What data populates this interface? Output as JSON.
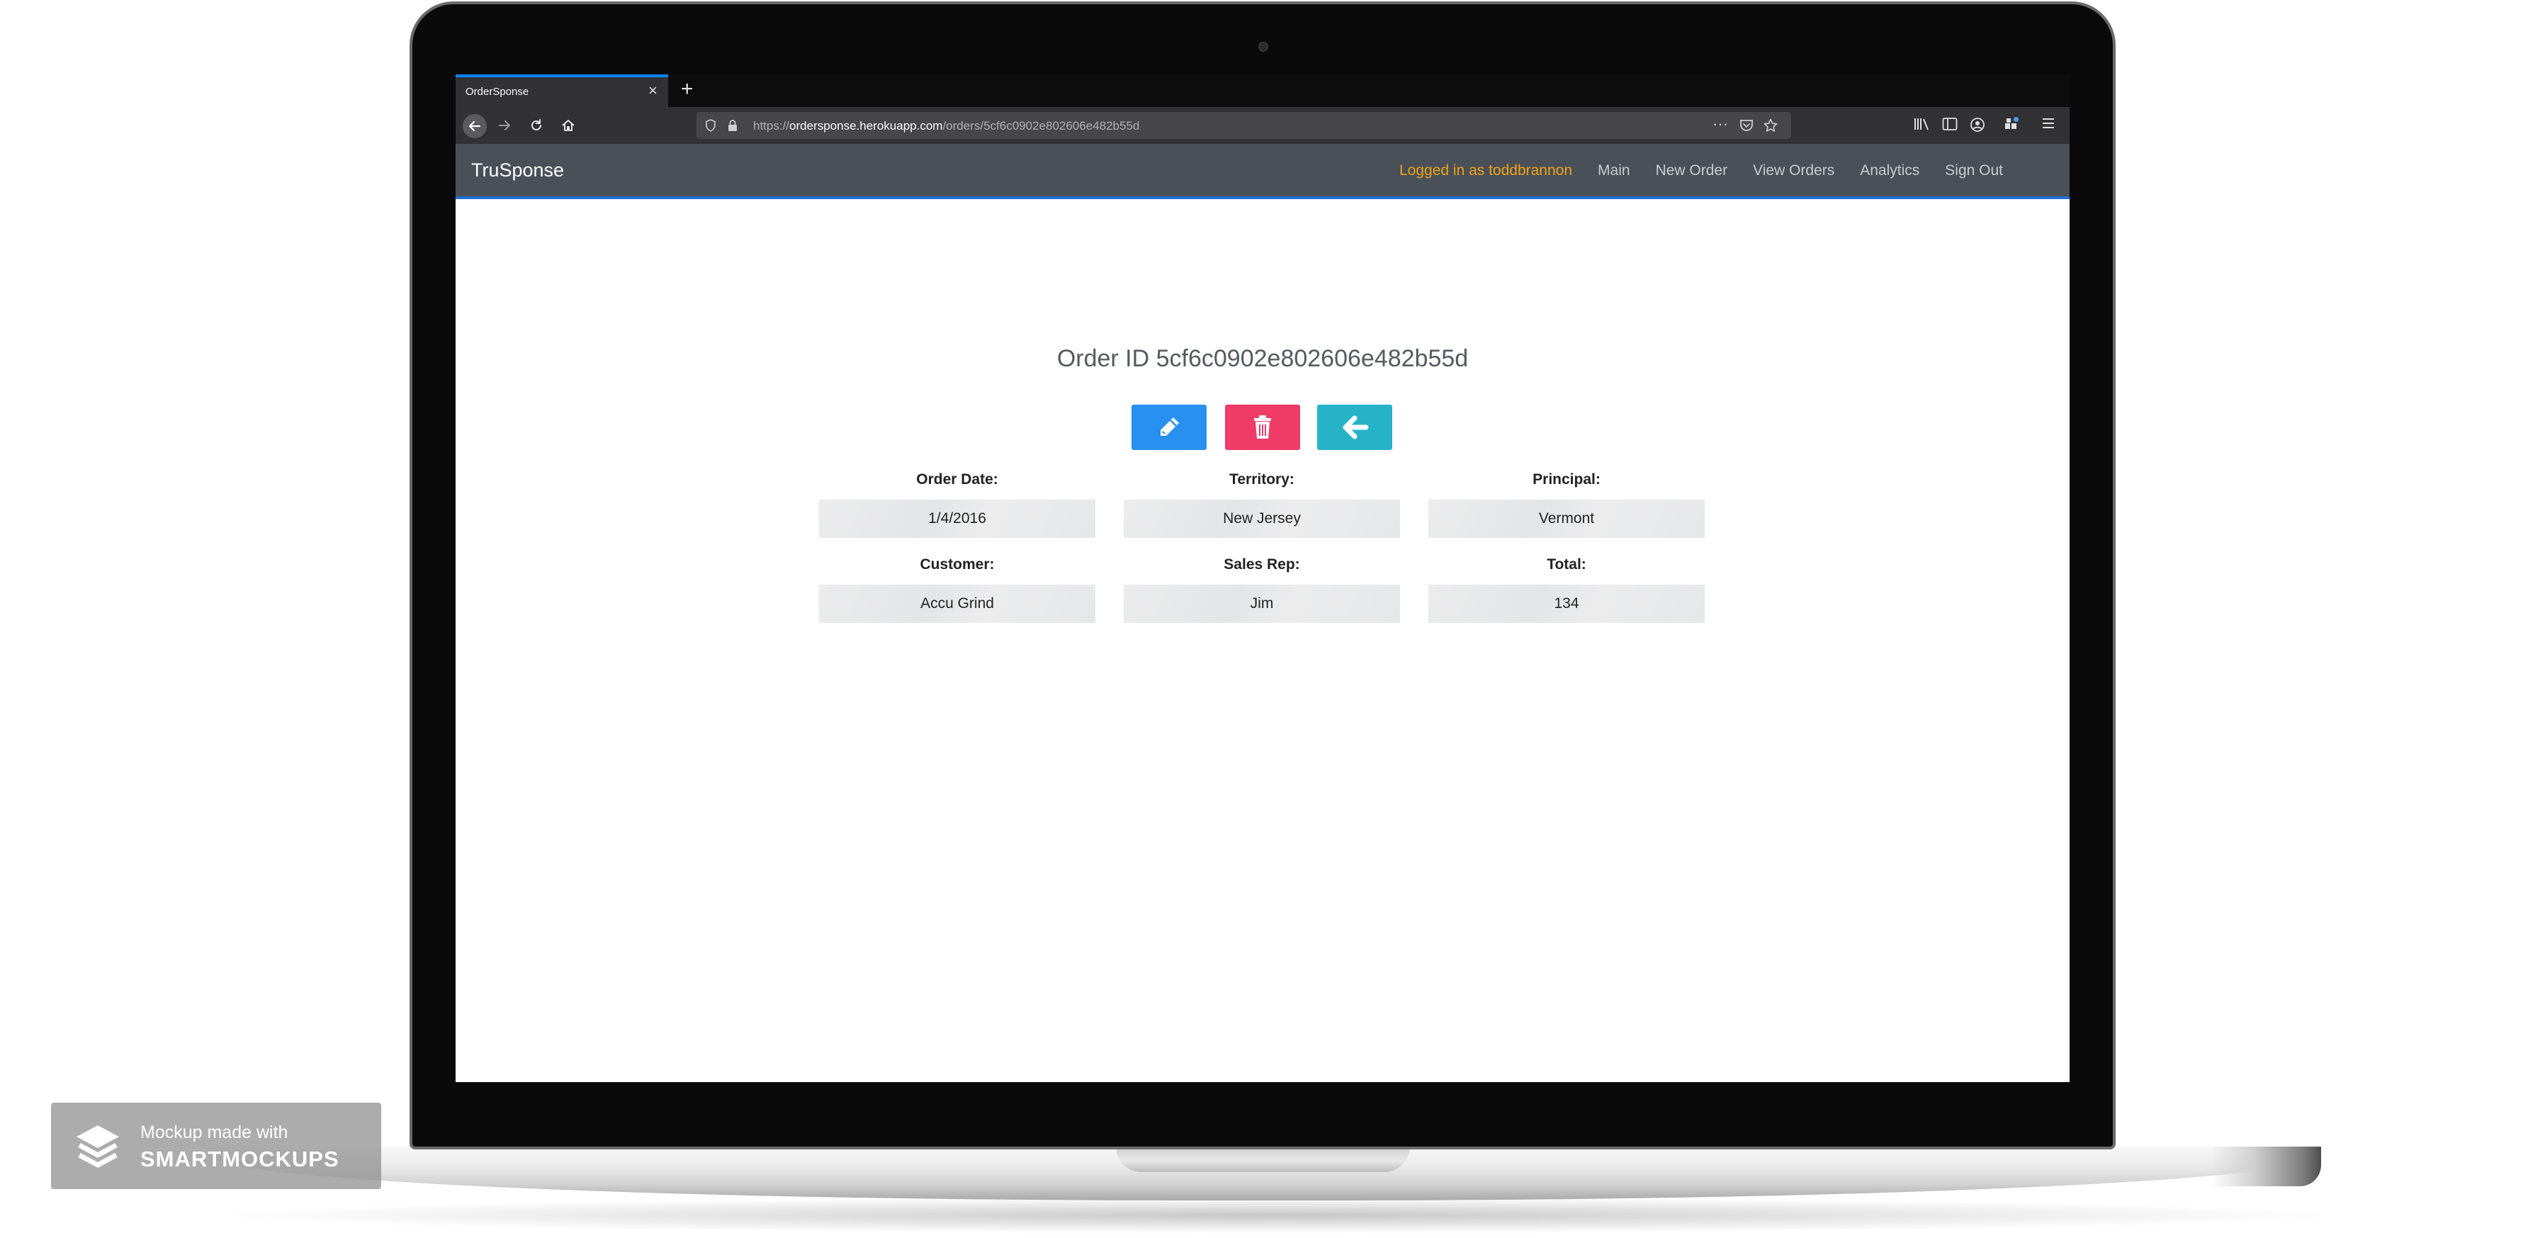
{
  "browser": {
    "tab_title": "OrderSponse",
    "tab_close": "×",
    "new_tab": "+",
    "url_prefix": "https://",
    "url_host": "ordersponse.herokuapp.com",
    "url_path": "/orders/5cf6c0902e802606e482b55d",
    "menu_dots": "···"
  },
  "app": {
    "brand": "TruSponse",
    "nav": {
      "logged_in": "Logged in as toddbrannon",
      "main": "Main",
      "new_order": "New Order",
      "view_orders": "View Orders",
      "analytics": "Analytics",
      "sign_out": "Sign Out"
    },
    "accent": "#1f6fd1",
    "user_color": "#f0a318"
  },
  "order": {
    "title": "Order ID 5cf6c0902e802606e482b55d",
    "buttons": {
      "edit_color": "#2890ef",
      "delete_color": "#ef3b66",
      "back_color": "#26b3c8"
    },
    "fields": [
      {
        "label": "Order Date:",
        "value": "1/4/2016"
      },
      {
        "label": "Territory:",
        "value": "New Jersey"
      },
      {
        "label": "Principal:",
        "value": "Vermont"
      },
      {
        "label": "Customer:",
        "value": "Accu Grind"
      },
      {
        "label": "Sales Rep:",
        "value": "Jim"
      },
      {
        "label": "Total:",
        "value": "134"
      }
    ]
  },
  "watermark": {
    "line1": "Mockup made with",
    "line2": "SMARTMOCKUPS"
  }
}
